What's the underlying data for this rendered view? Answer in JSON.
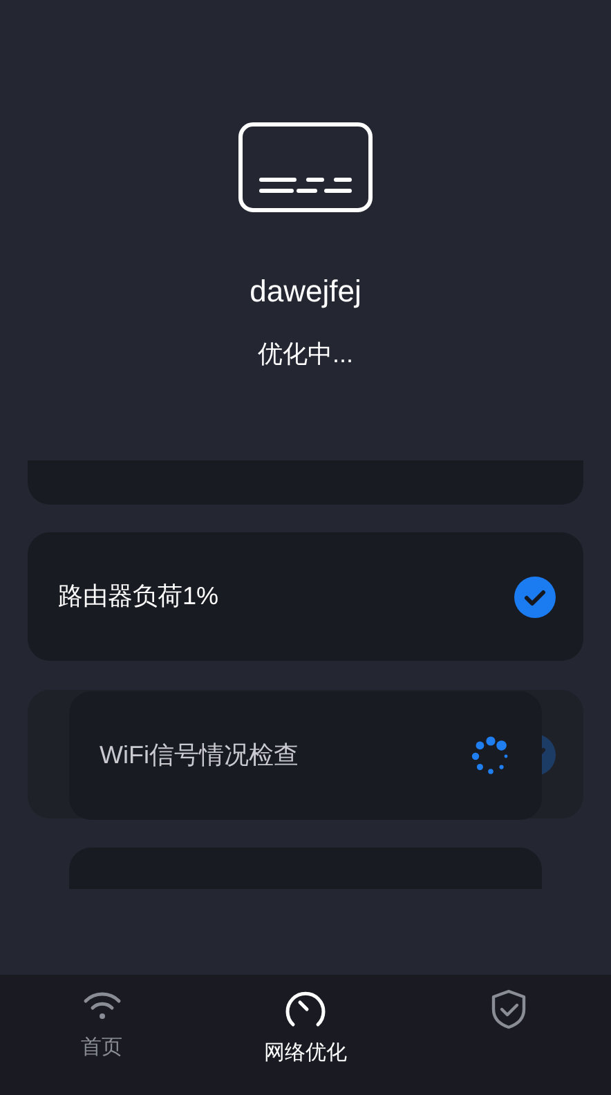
{
  "device": {
    "name": "dawejfej",
    "status": "优化中..."
  },
  "checks": [
    {
      "kind": "empty"
    },
    {
      "kind": "item",
      "label": "路由器负荷1%",
      "done": true
    },
    {
      "kind": "fading",
      "done": true
    },
    {
      "kind": "active",
      "label": "WiFi信号情况检查",
      "done": false
    },
    {
      "kind": "empty"
    }
  ],
  "nav": [
    {
      "label": "首页",
      "selected": false
    },
    {
      "label": "网络优化",
      "selected": true
    },
    {
      "selected": false
    }
  ]
}
